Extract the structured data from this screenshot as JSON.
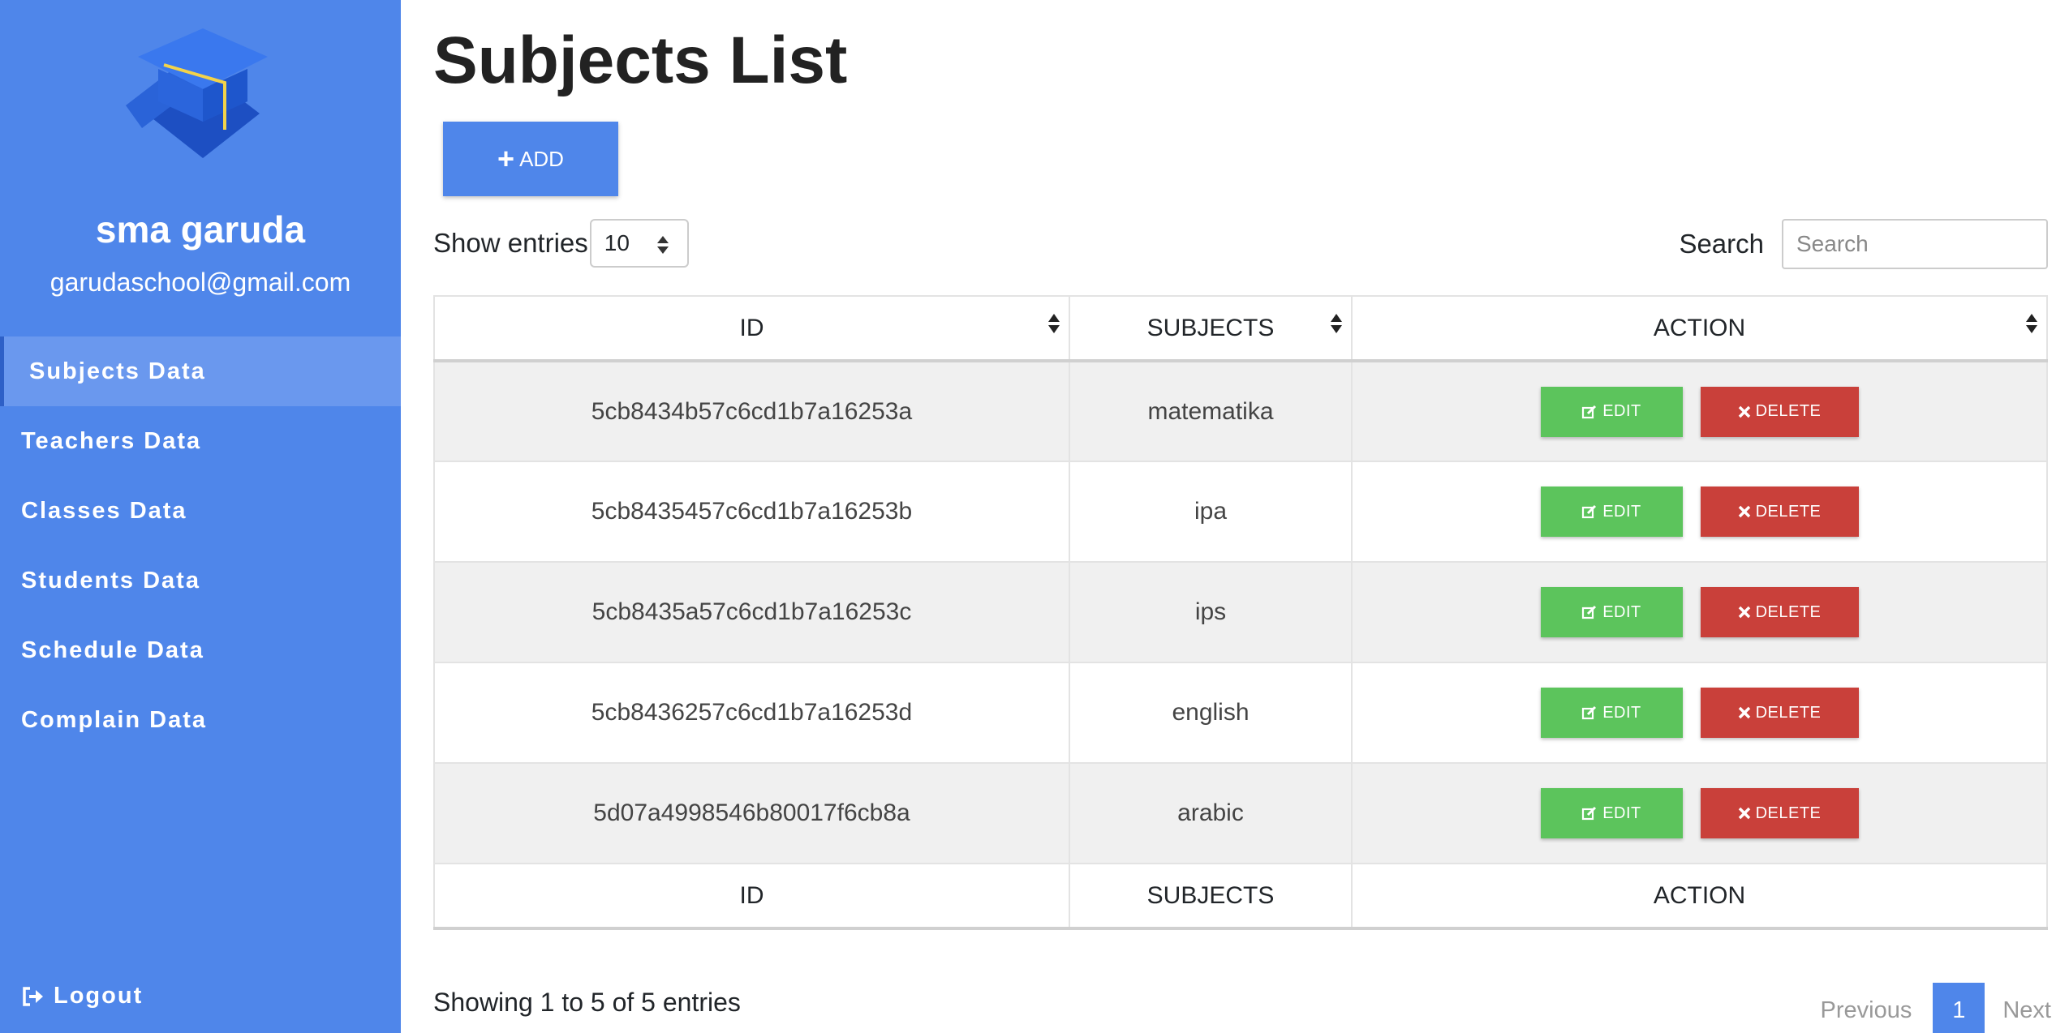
{
  "sidebar": {
    "school_name": "sma garuda",
    "email": "garudaschool@gmail.com",
    "items": [
      {
        "label": "Subjects Data",
        "active": true
      },
      {
        "label": "Teachers Data"
      },
      {
        "label": "Classes Data"
      },
      {
        "label": "Students Data"
      },
      {
        "label": "Schedule Data"
      },
      {
        "label": "Complain Data"
      }
    ],
    "logout_label": "Logout"
  },
  "main": {
    "title": "Subjects List",
    "add_label": "ADD",
    "show_entries_label": "Show entries",
    "entries_value": "10",
    "search_label": "Search",
    "search_placeholder": "Search",
    "columns": [
      "ID",
      "SUBJECTS",
      "ACTION"
    ],
    "rows": [
      {
        "id": "5cb8434b57c6cd1b7a16253a",
        "subject": "matematika"
      },
      {
        "id": "5cb8435457c6cd1b7a16253b",
        "subject": "ipa"
      },
      {
        "id": "5cb8435a57c6cd1b7a16253c",
        "subject": "ips"
      },
      {
        "id": "5cb8436257c6cd1b7a16253d",
        "subject": "english"
      },
      {
        "id": "5d07a4998546b80017f6cb8a",
        "subject": "arabic"
      }
    ],
    "edit_label": "EDIT",
    "delete_label": "DELETE",
    "info": "Showing 1 to 5 of 5 entries",
    "pagination": {
      "previous": "Previous",
      "current": "1",
      "next": "Next"
    }
  },
  "colors": {
    "primary": "#4f86ea",
    "edit": "#5cc45c",
    "delete": "#c9403a"
  }
}
